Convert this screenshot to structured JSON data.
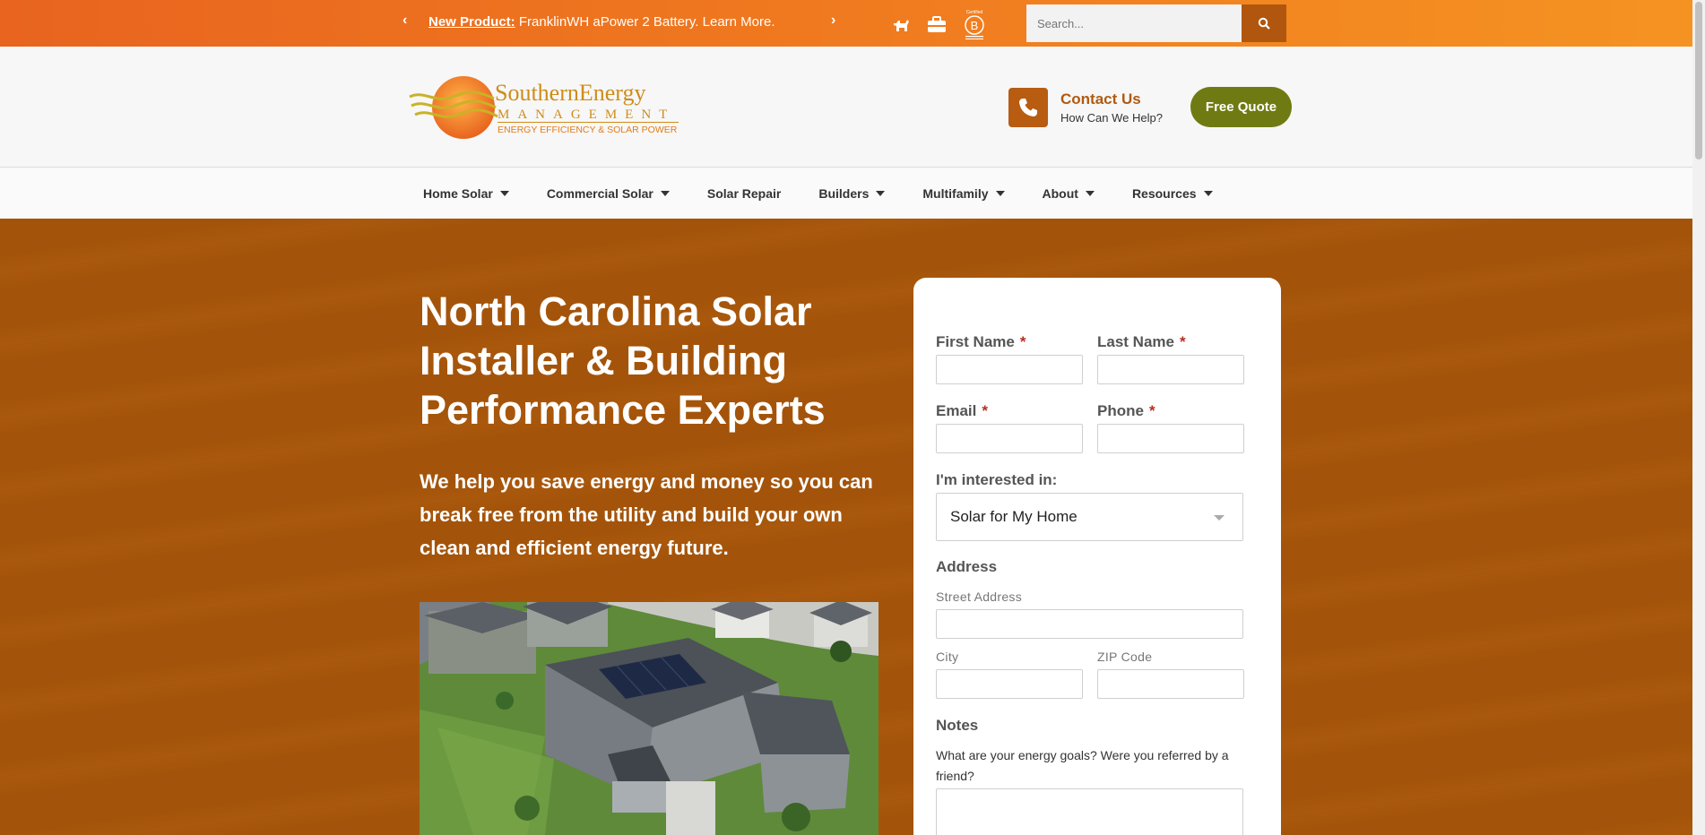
{
  "topbar": {
    "announcement_lead": "New Product:",
    "announcement_text": " FranklinWH aPower 2 Battery. Learn More.",
    "prev_glyph": "‹",
    "next_glyph": "›",
    "icons": [
      "dog-icon",
      "briefcase-icon",
      "b-corp-certified-icon"
    ],
    "search_placeholder": "Search..."
  },
  "header": {
    "logo": {
      "line1": "SouthernEnergy",
      "line2": "MANAGEMENT",
      "tagline": "ENERGY EFFICIENCY & SOLAR POWER"
    },
    "contact_title": "Contact Us",
    "contact_sub": "How Can We Help?",
    "quote_label": "Free Quote"
  },
  "nav": {
    "items": [
      {
        "label": "Home Solar"
      },
      {
        "label": "Commercial Solar"
      },
      {
        "label": "Solar Repair"
      },
      {
        "label": "Builders"
      },
      {
        "label": "Multifamily"
      },
      {
        "label": "About"
      },
      {
        "label": "Resources"
      }
    ]
  },
  "hero": {
    "title": "North Carolina Solar Installer & Building Performance Experts",
    "lead": "We help you save energy and money so you can break free from the utility and build your own clean and efficient energy future."
  },
  "form": {
    "first_name": "First Name",
    "last_name": "Last Name",
    "email": "Email",
    "phone": "Phone",
    "required_mark": "*",
    "interest_label": "I'm interested in:",
    "interest_value": "Solar for My Home",
    "address_label": "Address",
    "street_label": "Street Address",
    "city_label": "City",
    "zip_label": "ZIP Code",
    "notes_label": "Notes",
    "notes_desc": "What are your energy goals? Were you referred by a friend?"
  },
  "colors": {
    "topbar_start": "#e8641f",
    "topbar_end": "#f59322",
    "hero_bg": "#a4540a",
    "brand_brown": "#b05a10",
    "quote_green": "#6f7b12"
  }
}
